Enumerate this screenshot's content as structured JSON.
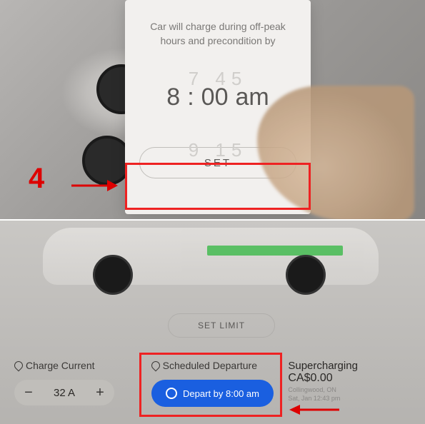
{
  "top": {
    "modal_desc": "Car will charge during off-peak hours and precondition by",
    "time_hour": "8",
    "time_sep": ":",
    "time_min": "00",
    "time_ampm": "am",
    "ghost_above": "7   45",
    "ghost_below": "9   15",
    "set_label": "SET",
    "annotation_number": "4"
  },
  "bottom": {
    "set_limit_label": "SET LIMIT",
    "charge_current_label": "Charge Current",
    "amp_value": "32 A",
    "minus": "−",
    "plus": "+",
    "scheduled_label": "Scheduled Departure",
    "depart_btn_label": "Depart by 8:00 am",
    "supercharging_label": "Supercharging",
    "supercharging_price": "CA$0.00",
    "supercharging_loc": "Collingwood, ON",
    "supercharging_time": "Sat, Jan 12:43 pm"
  },
  "colors": {
    "accent_blue": "#1a5fe0",
    "annotation_red": "#e22222",
    "charge_green": "#2dbd3e"
  }
}
